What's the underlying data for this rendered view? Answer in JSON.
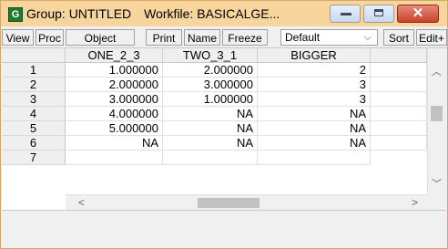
{
  "window": {
    "title": "Group: UNTITLED",
    "workfile": "Workfile: BASICALGE...",
    "icon": "G"
  },
  "toolbar": {
    "buttons": [
      "View",
      "Proc",
      "Object",
      "Print",
      "Name",
      "Freeze",
      "Sort",
      "Edit+"
    ],
    "display_select": "Default"
  },
  "columns": [
    "ONE_2_3",
    "TWO_3_1",
    "BIGGER"
  ],
  "rows": [
    {
      "label": "1",
      "values": [
        "1.000000",
        "2.000000",
        "2"
      ]
    },
    {
      "label": "2",
      "values": [
        "2.000000",
        "3.000000",
        "3"
      ]
    },
    {
      "label": "3",
      "values": [
        "3.000000",
        "1.000000",
        "3"
      ]
    },
    {
      "label": "4",
      "values": [
        "4.000000",
        "NA",
        "NA"
      ]
    },
    {
      "label": "5",
      "values": [
        "5.000000",
        "NA",
        "NA"
      ]
    },
    {
      "label": "6",
      "values": [
        "NA",
        "NA",
        "NA"
      ]
    },
    {
      "label": "7",
      "values": [
        "",
        "",
        ""
      ]
    }
  ],
  "colors": {
    "title_bar": "#f7d59c",
    "close_button": "#c8432b",
    "header_bg": "#efefef"
  }
}
